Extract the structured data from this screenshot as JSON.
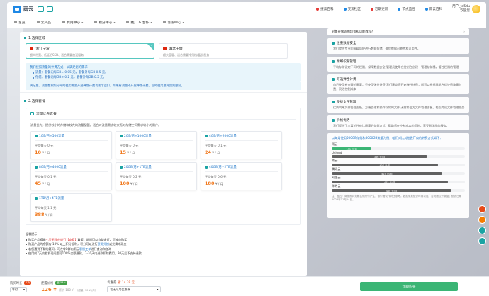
{
  "header": {
    "logo_text": "雨云",
    "links": [
      {
        "label": "搜索百科",
        "icon": "search-icon",
        "color": "#e53935"
      },
      {
        "label": "交流社区",
        "icon": "chat-icon",
        "color": "#1e88e5"
      },
      {
        "label": "近期更新",
        "icon": "refresh-icon",
        "color": "#e53935"
      },
      {
        "label": "节点监控",
        "icon": "monitor-icon",
        "color": "#1e88e5"
      },
      {
        "label": "雨云百科",
        "icon": "book-icon",
        "color": "#1e88e5"
      }
    ],
    "user_name": "用户_te5du",
    "user_greeting": "欢迎您"
  },
  "nav": {
    "items": [
      {
        "label": "总览",
        "caret": false
      },
      {
        "label": "云产品",
        "caret": false
      },
      {
        "label": "费用中心",
        "caret": true
      },
      {
        "label": "积分中心",
        "caret": true
      },
      {
        "label": "推广 & 合作",
        "caret": true
      },
      {
        "label": "客服中心",
        "caret": true
      }
    ]
  },
  "region": {
    "heading": "1.选择区域",
    "cards": [
      {
        "name": "浙江宁波",
        "desc": "超大带宽、低延迟SSD、适合需要加速服务",
        "selected": true
      },
      {
        "name": "湖北十堰",
        "desc": "超大容量、适合需要冷归档/备份服务",
        "selected": false
      }
    ]
  },
  "price_note": {
    "title": "我们按照流量的计费方式，以满足您的需求",
    "lines": [
      "流量：套餐内每GB≈ 0.05 元，套餐外每GB 0.5 元。",
      "存储：套餐内每GB≈ 0.2 元，套餐外每GB 0.5 元。"
    ],
    "info": "满足量、流量都按照分开的使用需要开启弹性计费功能才会扣。如果有流量不开启弹性计费，您的使用量将受到限制。"
  },
  "plans": {
    "heading": "2.选择套餐",
    "box_title": "流量优先套餐",
    "desc": "流量优先，提供较小的存储和较大的流量配额，适合对流量需求较大而对存储空间需求较小的用户。",
    "cards": [
      {
        "name": "1GB/月+500流量",
        "unit_label": "平均每天",
        "unit_value": "0 元",
        "price": "10",
        "price_suffix": "¥ / 月"
      },
      {
        "name": "2GB/月+1000流量",
        "unit_label": "平均每天",
        "unit_value": "0 元",
        "price": "15",
        "price_suffix": "¥ / 月"
      },
      {
        "name": "4GB/月+2000流量",
        "unit_label": "平均每天",
        "unit_value": "0.1 元",
        "price": "24",
        "price_suffix": "¥ / 月"
      },
      {
        "name": "8GB/月+4000流量",
        "unit_label": "平均每天",
        "unit_value": "0.1 元",
        "price": "45",
        "price_suffix": "¥ / 月"
      },
      {
        "name": "20GB/月+1TB流量",
        "unit_label": "平均每天",
        "unit_value": "0.2 元",
        "price": "100",
        "price_suffix": "¥ / 月"
      },
      {
        "name": "40GB/月+2TB流量",
        "unit_label": "平均每天",
        "unit_value": "0.6 元",
        "price": "180",
        "price_suffix": "¥ / 月"
      },
      {
        "name": "1TB/月+4TB流量",
        "unit_label": "平均每天",
        "unit_value": "1.1 元",
        "price": "388",
        "price_suffix": "¥ / 月"
      }
    ]
  },
  "tips": {
    "heading": "温馨提示",
    "lines": [
      {
        "pre": "购买产品遵循",
        "hl": "七天无理由退订【查看】",
        "post": "政策，期间可以自助退订，可放心购买"
      },
      {
        "pre": "购买产品的余额有 10% 以上积分返利，积分可以进行",
        "hl": "资源兑换",
        "post": "或兑换成现金"
      },
      {
        "pre": "若您遇到不解的疑问，可在QQ群向雨云",
        "hl": "客服工单",
        "post": "进行查询和咨询"
      },
      {
        "pre": "使用前7天内若发现问题可100%全额退款，7-30天内退款",
        "hl": "",
        "post": "扣除费用，30天后不支持退款"
      }
    ]
  },
  "right": {
    "faq_title": "对象存储适用场景和功能教程?",
    "features": [
      {
        "title": "注重数据安全",
        "body": "我们提供专业的多级防护进行数据存储，确保数据可靠性和可用性。"
      },
      {
        "title": "精细权限管理",
        "body": "平均存储设定不同的权限，保障数据安全\n管理员使用在控制台创建一管理存储桶，管控权限的管理"
      },
      {
        "title": "可选弹性计费",
        "body": "自己使用有合理的需要，只使用弹性计费\n我们建议您开启弹性计费，即可以根据需求合适计费按需付费，灵活控制成本"
      },
      {
        "title": "便捷文件管理",
        "body": "优质简单文件管理面板，方便管理和操作存储的文件\n无需第三方文件管理面板，轻松完成文件管理任务"
      },
      {
        "title": "价格优势",
        "body": "我们提供了丰富的性价比最高的存储方式，帮助您在控制成本的同时，享受到优质的服务。"
      }
    ],
    "speed_head": "以每月使用500GB存储和5000GB流量为例，咱们对比其他云厂商的计费方式如下：",
    "bars": [
      {
        "name": "雨云",
        "value": "155 元/月",
        "fraction": 0.3,
        "color": "#3bb575"
      },
      {
        "name": "Ucloud",
        "value": "366 元/月",
        "fraction": 0.72,
        "color": "#616161"
      },
      {
        "name": "青云",
        "value": "407 元/月",
        "fraction": 0.8,
        "color": "#616161"
      },
      {
        "name": "腾讯云",
        "value": "425 元/月",
        "fraction": 0.83,
        "color": "#616161"
      },
      {
        "name": "阿里云",
        "value": "445 元/月",
        "fraction": 0.87,
        "color": "#616161"
      },
      {
        "name": "华为云",
        "value": "460 元/月",
        "fraction": 0.9,
        "color": "#616161"
      }
    ],
    "foot": "注：各云厂商按照同规格实例所付产生，该价格仅作对比参考。数据采集统计时间以自广告页面公开数据；统计日期2023年11月24日。"
  },
  "bottom": {
    "duration_label": "购买时长",
    "duration_badge": "7折",
    "duration_value": "年付",
    "price_label": "配置价格",
    "price_badge": "省 54%",
    "price_value": "126 ¥",
    "price_old": "原价 180 ¥",
    "price_note": "（超量: 10 ¥ /月）",
    "coupon_label": "优惠券",
    "coupon_amount": "省 14.39 元",
    "coupon_value": "暂无可用优惠券",
    "buy_label": "立即购买"
  }
}
